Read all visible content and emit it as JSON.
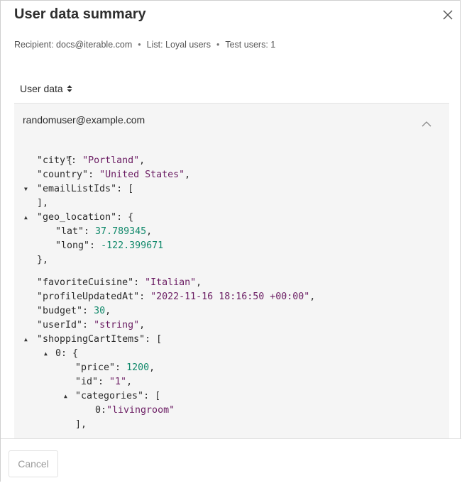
{
  "dialog": {
    "title": "User data summary",
    "meta": {
      "recipient": "Recipient: docs@iterable.com",
      "list": "List: Loyal users",
      "test_users": "Test users: 1",
      "separator": "•"
    },
    "section_label": "User data",
    "user_email": "randomuser@example.com",
    "cancel_label": "Cancel"
  },
  "json_view": {
    "open_brace": "{",
    "city_key": "\"city\"",
    "city_value": "\"Portland\"",
    "country_key": "\"country\"",
    "country_value": "\"United States\"",
    "email_list_key": "\"emailListIds\"",
    "email_list_open": "[",
    "email_list_close": "],",
    "geo_key": "\"geo_location\"",
    "geo_open": "{",
    "lat_key": "\"lat\"",
    "lat_value": "37.789345",
    "long_key": "\"long\"",
    "long_value": "-122.399671",
    "geo_close": "},",
    "cuisine_key": "\"favoriteCuisine\"",
    "cuisine_value": "\"Italian\"",
    "profile_key": "\"profileUpdatedAt\"",
    "profile_value": "\"2022-11-16 18:16:50 +00:00\"",
    "budget_key": "\"budget\"",
    "budget_value": "30",
    "userid_key": "\"userId\"",
    "userid_value": "\"string\"",
    "cart_key": "\"shoppingCartItems\"",
    "cart_open": "[",
    "item0_index": "0:",
    "item0_open": "{",
    "price_key": "\"price\"",
    "price_value": "1200",
    "id_key": "\"id\"",
    "id_value": "\"1\"",
    "categories_key": "\"categories\"",
    "categories_open": "[",
    "cat0_index": "0:",
    "cat0_value": "\"livingroom\"",
    "categories_close": "],"
  }
}
